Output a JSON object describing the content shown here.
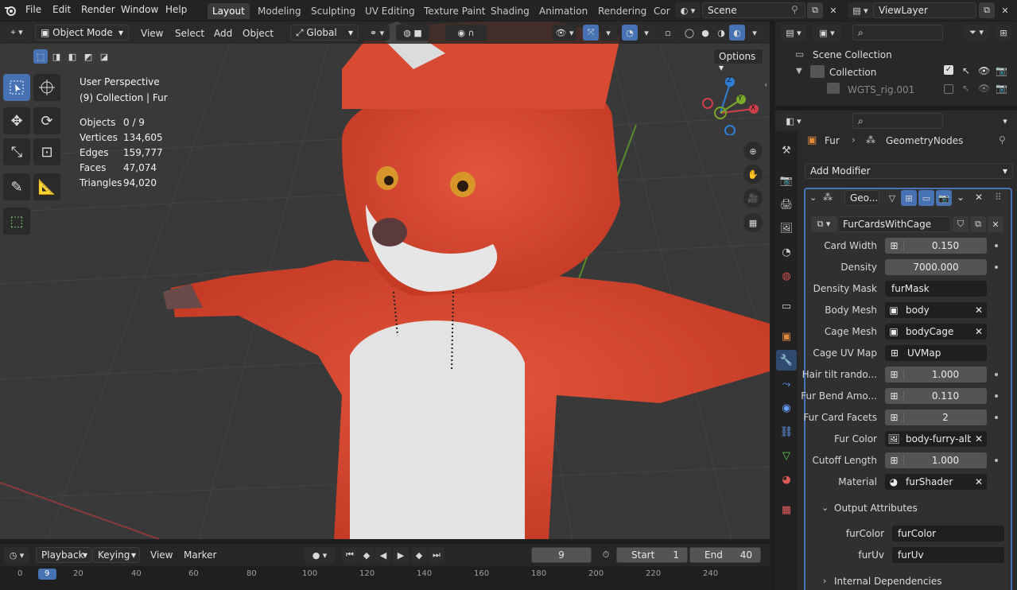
{
  "topbar": {
    "menus": [
      "File",
      "Edit",
      "Render",
      "Window",
      "Help"
    ],
    "workspaces": [
      "Layout",
      "Modeling",
      "Sculpting",
      "UV Editing",
      "Texture Paint",
      "Shading",
      "Animation",
      "Rendering",
      "Cor"
    ],
    "active_workspace": "Layout",
    "scene": "Scene",
    "view_layer": "ViewLayer"
  },
  "viewport_header": {
    "mode": "Object Mode",
    "menus": [
      "View",
      "Select",
      "Add",
      "Object"
    ],
    "orientation": "Global",
    "options_label": "Options"
  },
  "overlay": {
    "perspective": "User Perspective",
    "collection": "(9) Collection | Fur",
    "stats": [
      {
        "label": "Objects",
        "value": "0 / 9"
      },
      {
        "label": "Vertices",
        "value": "134,605"
      },
      {
        "label": "Edges",
        "value": "159,777"
      },
      {
        "label": "Faces",
        "value": "47,074"
      },
      {
        "label": "Triangles",
        "value": "94,020"
      }
    ]
  },
  "gizmo": {
    "x": "X",
    "y": "Y",
    "z": "Z"
  },
  "outliner": {
    "scene_collection": "Scene Collection",
    "collection": "Collection",
    "rig": "WGTS_rig.001"
  },
  "properties": {
    "breadcrumb_object": "Fur",
    "breadcrumb_modifier": "GeometryNodes",
    "add_modifier": "Add Modifier",
    "modifier_name": "Geo...",
    "node_group": "FurCardsWithCage",
    "fields": [
      {
        "label": "Card Width",
        "value": "0.150",
        "kind": "number"
      },
      {
        "label": "Density",
        "value": "7000.000",
        "kind": "plain"
      },
      {
        "label": "Density Mask",
        "value": "furMask",
        "kind": "attr"
      },
      {
        "label": "Body Mesh",
        "value": "body",
        "kind": "object"
      },
      {
        "label": "Cage Mesh",
        "value": "bodyCage",
        "kind": "object"
      },
      {
        "label": "Cage UV Map",
        "value": "UVMap",
        "kind": "attrdark"
      },
      {
        "label": "Hair tilt rando...",
        "value": "1.000",
        "kind": "number"
      },
      {
        "label": "Fur Bend Amo...",
        "value": "0.110",
        "kind": "number"
      },
      {
        "label": "Fur Card Facets",
        "value": "2",
        "kind": "number"
      },
      {
        "label": "Fur Color",
        "value": "body-furry-alb...",
        "kind": "image"
      },
      {
        "label": "Cutoff Length",
        "value": "1.000",
        "kind": "number"
      },
      {
        "label": "Material",
        "value": "furShader",
        "kind": "material"
      }
    ],
    "output_attributes_label": "Output Attributes",
    "outputs": [
      {
        "label": "furColor",
        "value": "furColor"
      },
      {
        "label": "furUv",
        "value": "furUv"
      }
    ],
    "internal_deps": "Internal Dependencies"
  },
  "timeline": {
    "menus": [
      "Playback",
      "Keying",
      "View",
      "Marker"
    ],
    "current_frame": "9",
    "start_label": "Start",
    "start": "1",
    "end_label": "End",
    "end": "40",
    "ticks": [
      "0",
      "9",
      "20",
      "40",
      "60",
      "80",
      "100",
      "120",
      "140",
      "160",
      "180",
      "200",
      "220",
      "240"
    ]
  }
}
